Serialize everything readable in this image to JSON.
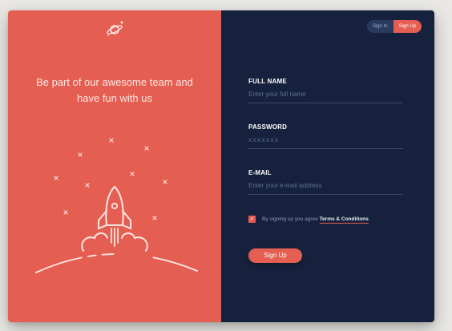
{
  "toggle": {
    "signin_label": "Sign In",
    "signup_label": "Sign Up",
    "active": "Sign Up"
  },
  "hero": {
    "tagline": "Be part of our awesome team and have fun with us"
  },
  "form": {
    "full_name": {
      "label": "FULL NAME",
      "placeholder": "Enter your full name"
    },
    "password": {
      "label": "PASSWORD",
      "placeholder": "xxxxxxx"
    },
    "email": {
      "label": "E-MAIL",
      "placeholder": "Enter your e-mail address"
    },
    "agreement": {
      "checked": true,
      "text": "By signing up you agree ",
      "link": "Terms & Conditions"
    },
    "submit_label": "Sign Up"
  },
  "colors": {
    "accent": "#e55e52",
    "panel_dark": "#16223d",
    "page_bg": "#e9e8e4"
  },
  "icons": {
    "logo": "planet-icon",
    "illustration": "rocket-icon",
    "checkbox": "checkmark-icon"
  }
}
